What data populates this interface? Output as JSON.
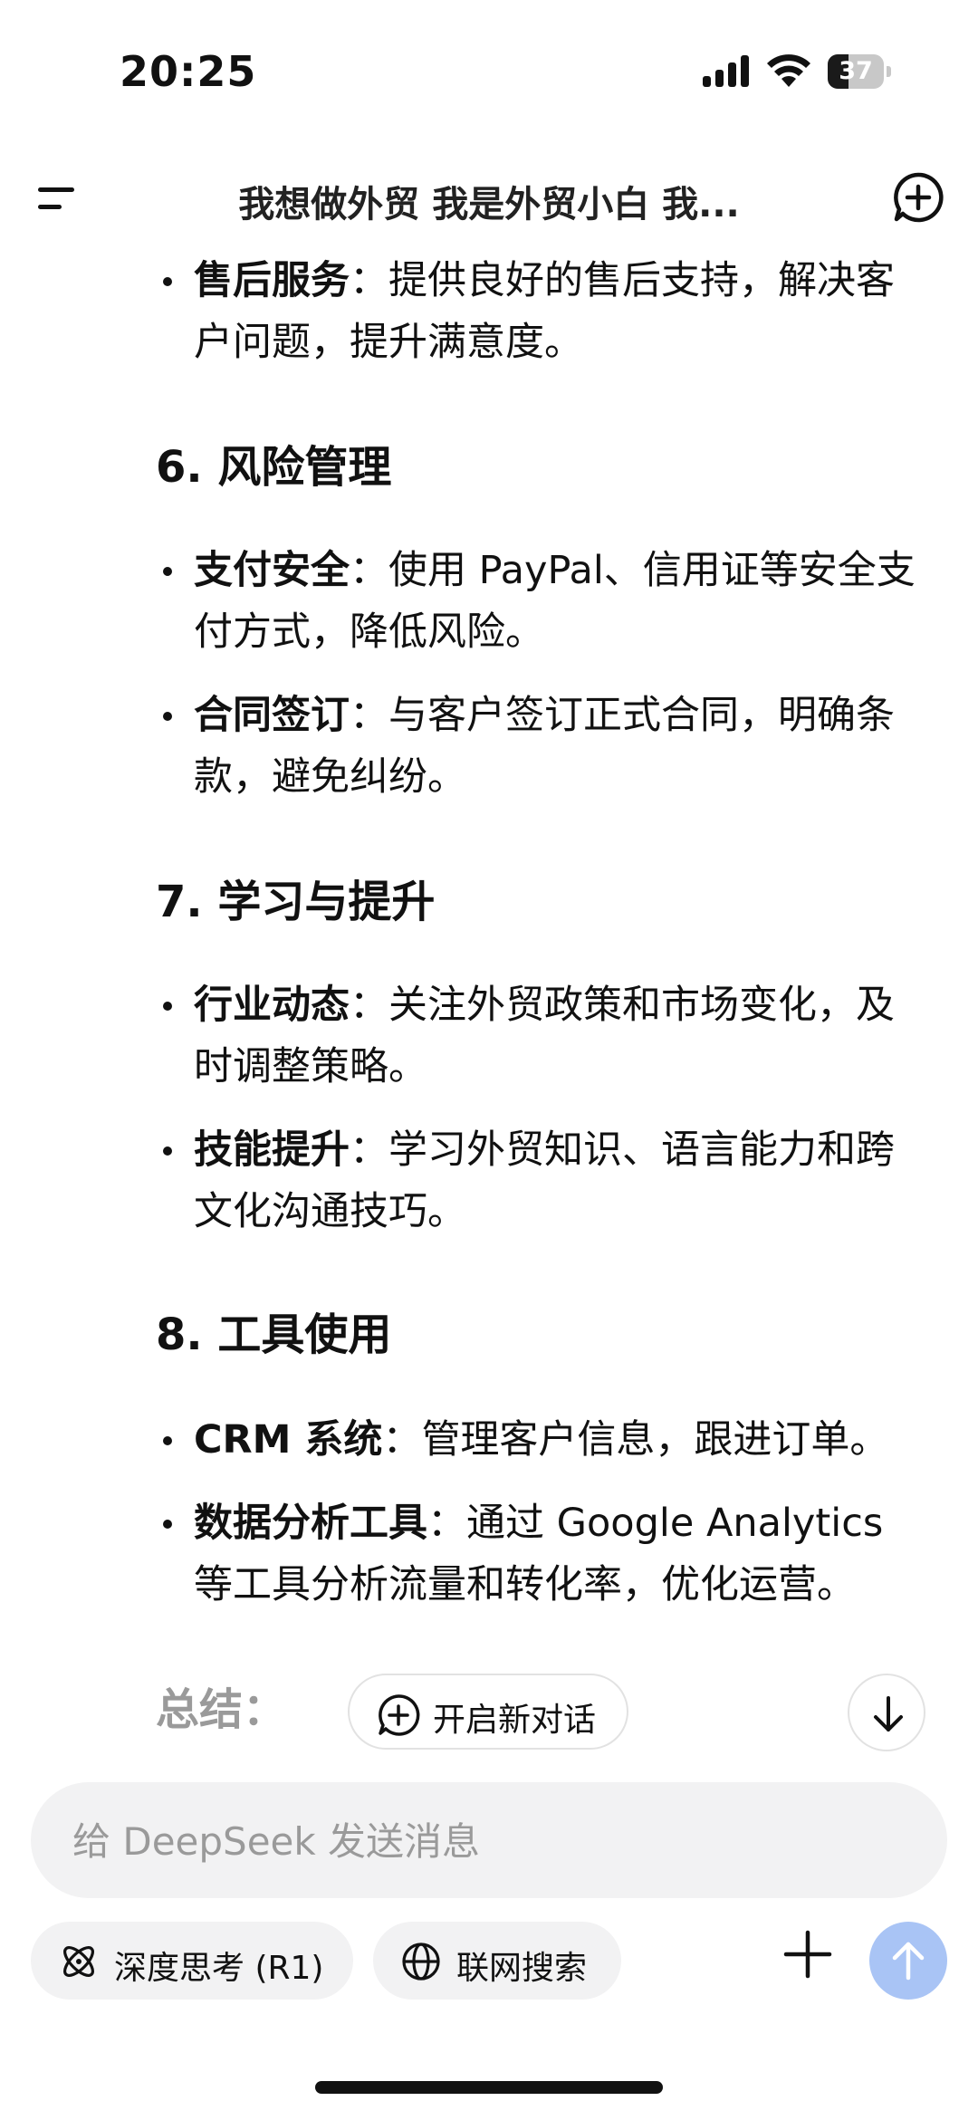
{
  "status_bar": {
    "time": "20:25",
    "battery_percent": 37,
    "battery_label": "37"
  },
  "header": {
    "title": "我想做外贸 我是外贸小白 我..."
  },
  "content": {
    "items": [
      {
        "type": "bullet",
        "bold": "售后服务",
        "sep": "：",
        "text": "提供良好的售后支持，解决客户问题，提升满意度。"
      },
      {
        "type": "heading",
        "text": "6. 风险管理"
      },
      {
        "type": "bullet",
        "bold": "支付安全",
        "sep": "：",
        "text": "使用 PayPal、信用证等安全支付方式，降低风险。"
      },
      {
        "type": "bullet",
        "bold": "合同签订",
        "sep": "：",
        "text": "与客户签订正式合同，明确条款，避免纠纷。"
      },
      {
        "type": "heading",
        "text": "7. 学习与提升"
      },
      {
        "type": "bullet",
        "bold": "行业动态",
        "sep": "：",
        "text": "关注外贸政策和市场变化，及时调整策略。"
      },
      {
        "type": "bullet",
        "bold": "技能提升",
        "sep": "：",
        "text": "学习外贸知识、语言能力和跨文化沟通技巧。"
      },
      {
        "type": "heading",
        "text": "8. 工具使用"
      },
      {
        "type": "bullet",
        "bold": "CRM 系统",
        "sep": "：",
        "text": "管理客户信息，跟进订单。"
      },
      {
        "type": "bullet",
        "bold": "数据分析工具",
        "sep": "：",
        "text": "通过 Google Analytics 等工具分析流量和转化率，优化运营。"
      }
    ],
    "summary_label": "总结：",
    "new_dialog_label": "开启新对话"
  },
  "composer": {
    "placeholder": "给 DeepSeek 发送消息",
    "value": "",
    "deep_think_label": "深度思考 (R1)",
    "web_search_label": "联网搜索"
  },
  "colors": {
    "send_button": "#a9c4f5",
    "input_bg": "#f2f2f3",
    "summary_text": "#9a9a9a"
  }
}
